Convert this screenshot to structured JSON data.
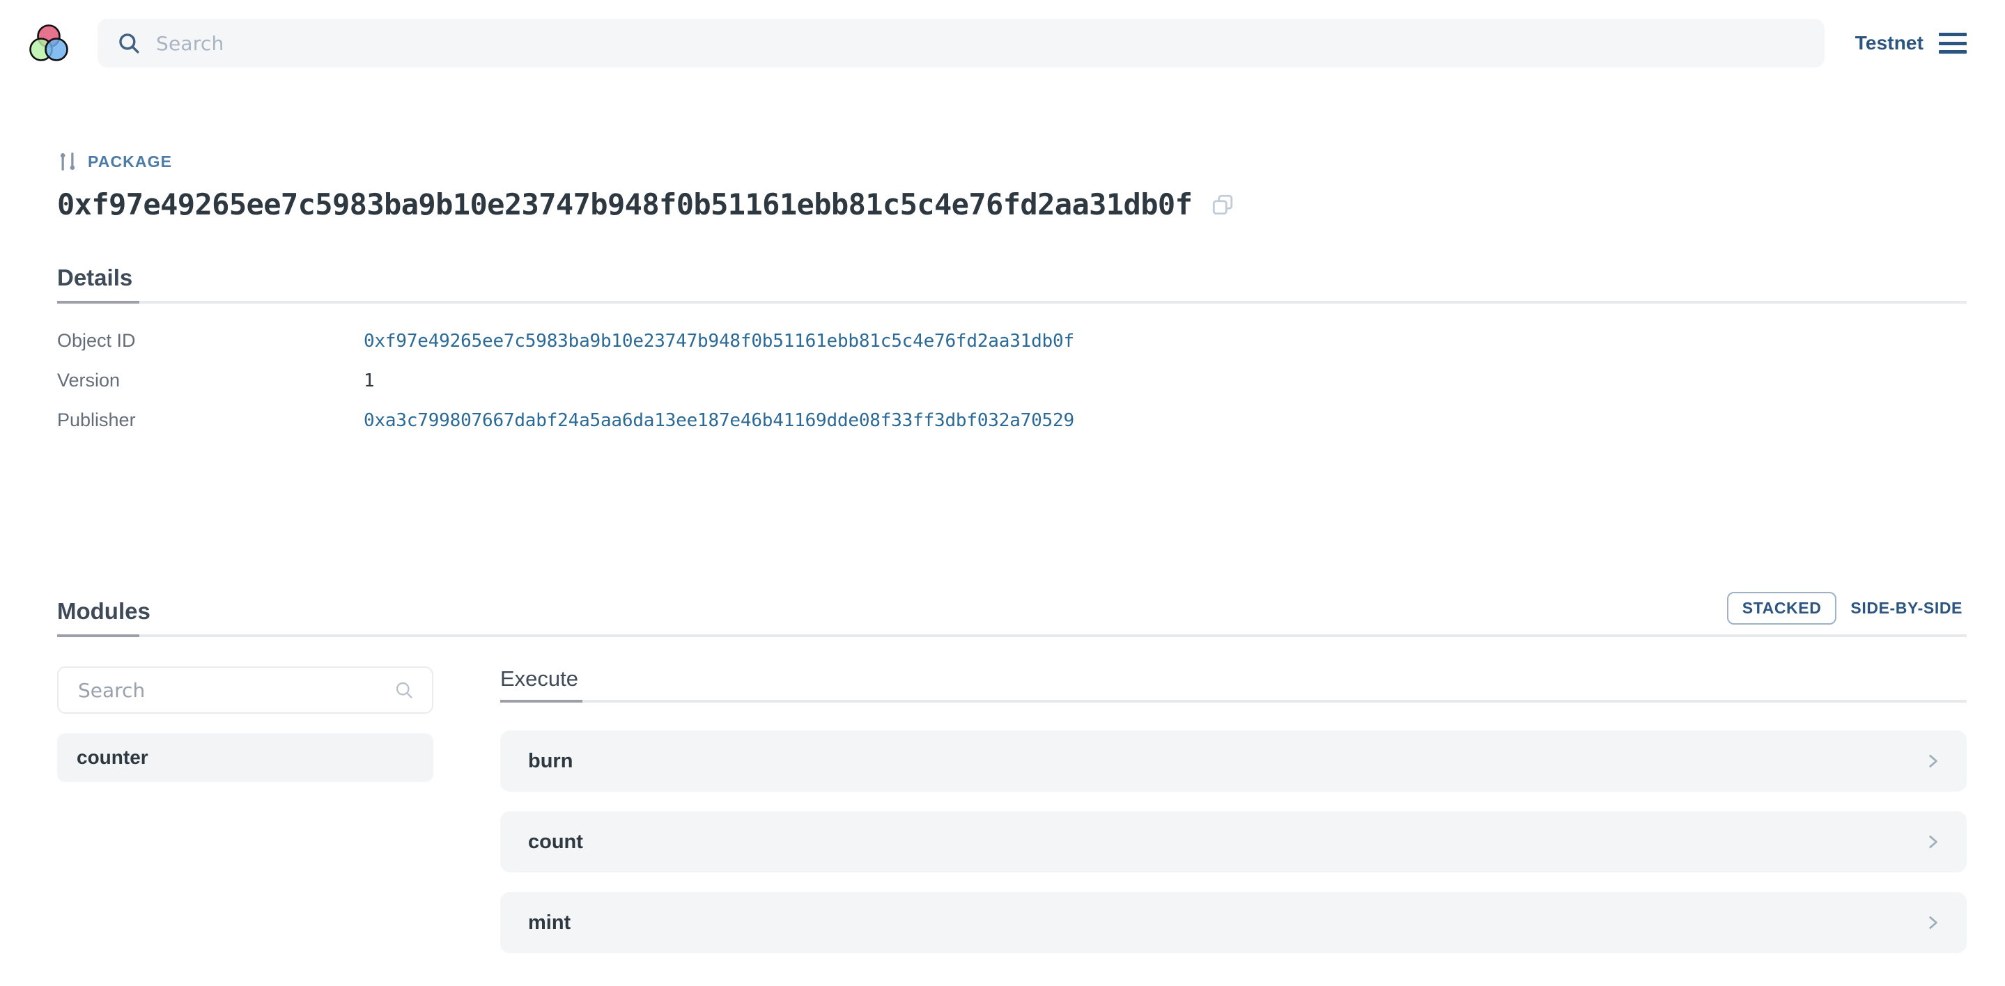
{
  "header": {
    "logo_name": "sui-explorer-logo",
    "search": {
      "placeholder": "Search"
    },
    "network": {
      "label": "Testnet",
      "menu_icon": "hamburger-icon"
    }
  },
  "object_header": {
    "kind_icon": "package-branch-icon",
    "kind_label": "PACKAGE",
    "object_id": "0xf97e49265ee7c5983ba9b10e23747b948f0b51161ebb81c5c4e76fd2aa31db0f",
    "copy_icon": "copy-icon"
  },
  "details": {
    "title": "Details",
    "rows": [
      {
        "label": "Object ID",
        "value": "0xf97e49265ee7c5983ba9b10e23747b948f0b51161ebb81c5c4e76fd2aa31db0f",
        "is_link": true
      },
      {
        "label": "Version",
        "value": "1",
        "is_link": false
      },
      {
        "label": "Publisher",
        "value": "0xa3c799807667dabf24a5aa6da13ee187e46b41169dde08f33ff3dbf032a70529",
        "is_link": true
      }
    ]
  },
  "modules": {
    "title": "Modules",
    "view_toggle": {
      "stacked": "STACKED",
      "side_by_side": "SIDE-BY-SIDE",
      "selected": "STACKED"
    },
    "search": {
      "placeholder": "Search",
      "icon": "search-icon"
    },
    "items": [
      {
        "name": "counter",
        "selected": true
      }
    ],
    "execute": {
      "title": "Execute",
      "functions": [
        {
          "name": "burn",
          "chevron": "chevron-right-icon"
        },
        {
          "name": "count",
          "chevron": "chevron-right-icon"
        },
        {
          "name": "mint",
          "chevron": "chevron-right-icon"
        }
      ]
    }
  },
  "colors": {
    "accent_blue": "#2b5580",
    "link_blue": "#2b6a96",
    "kind_label": "#4b7ba6",
    "text_dark": "#2e3840",
    "text_muted": "#656d78",
    "panel_bg": "#f3f5f7",
    "search_bg": "#f4f6f8"
  }
}
